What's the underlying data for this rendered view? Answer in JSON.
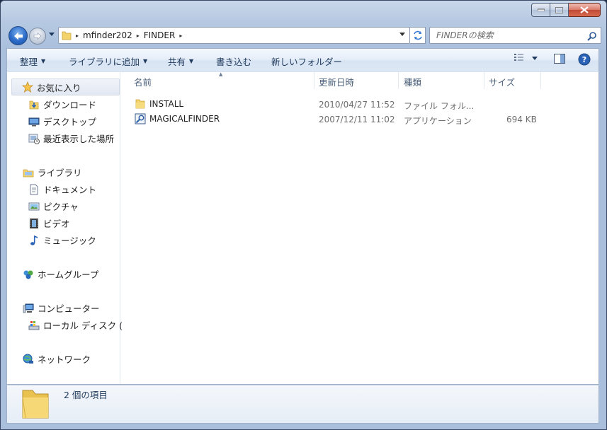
{
  "window": {
    "caption": {
      "minimize": "−",
      "maximize": "□",
      "close": "✕"
    }
  },
  "address": {
    "crumbs": [
      "mfinder202",
      "FINDER"
    ],
    "separator": "▸"
  },
  "search": {
    "placeholder": "FINDERの検索"
  },
  "toolbar": {
    "organize": "整理",
    "include_in_library": "ライブラリに追加",
    "share": "共有",
    "burn": "書き込む",
    "new_folder": "新しいフォルダー",
    "dropdown_glyph": "▼"
  },
  "nav": {
    "favorites": {
      "label": "お気に入り"
    },
    "downloads": {
      "label": "ダウンロード"
    },
    "desktop": {
      "label": "デスクトップ"
    },
    "recent": {
      "label": "最近表示した場所"
    },
    "libraries": {
      "label": "ライブラリ"
    },
    "documents": {
      "label": "ドキュメント"
    },
    "pictures": {
      "label": "ピクチャ"
    },
    "videos": {
      "label": "ビデオ"
    },
    "music": {
      "label": "ミュージック"
    },
    "homegroup": {
      "label": "ホームグループ"
    },
    "computer": {
      "label": "コンピューター"
    },
    "local_disk": {
      "label": "ローカル ディスク ("
    },
    "network": {
      "label": "ネットワーク"
    }
  },
  "columns": {
    "name": "名前",
    "date_modified": "更新日時",
    "type": "種類",
    "size": "サイズ",
    "sort_glyph": "▲"
  },
  "files": [
    {
      "name": "INSTALL",
      "date": "2010/04/27 11:52",
      "type": "ファイル フォル...",
      "size": "",
      "icon": "folder-icon"
    },
    {
      "name": "MAGICALFINDER",
      "date": "2007/12/11 11:02",
      "type": "アプリケーション",
      "size": "694 KB",
      "icon": "application-icon"
    }
  ],
  "status": {
    "item_count": "2 個の項目"
  },
  "colors": {
    "chrome": "#b6c9e2",
    "command_text": "#1e395b",
    "header_text": "#4c607a",
    "secondary_text": "#6d6d6d",
    "folder": "#f3d36b",
    "close_button": "#c14a35"
  }
}
